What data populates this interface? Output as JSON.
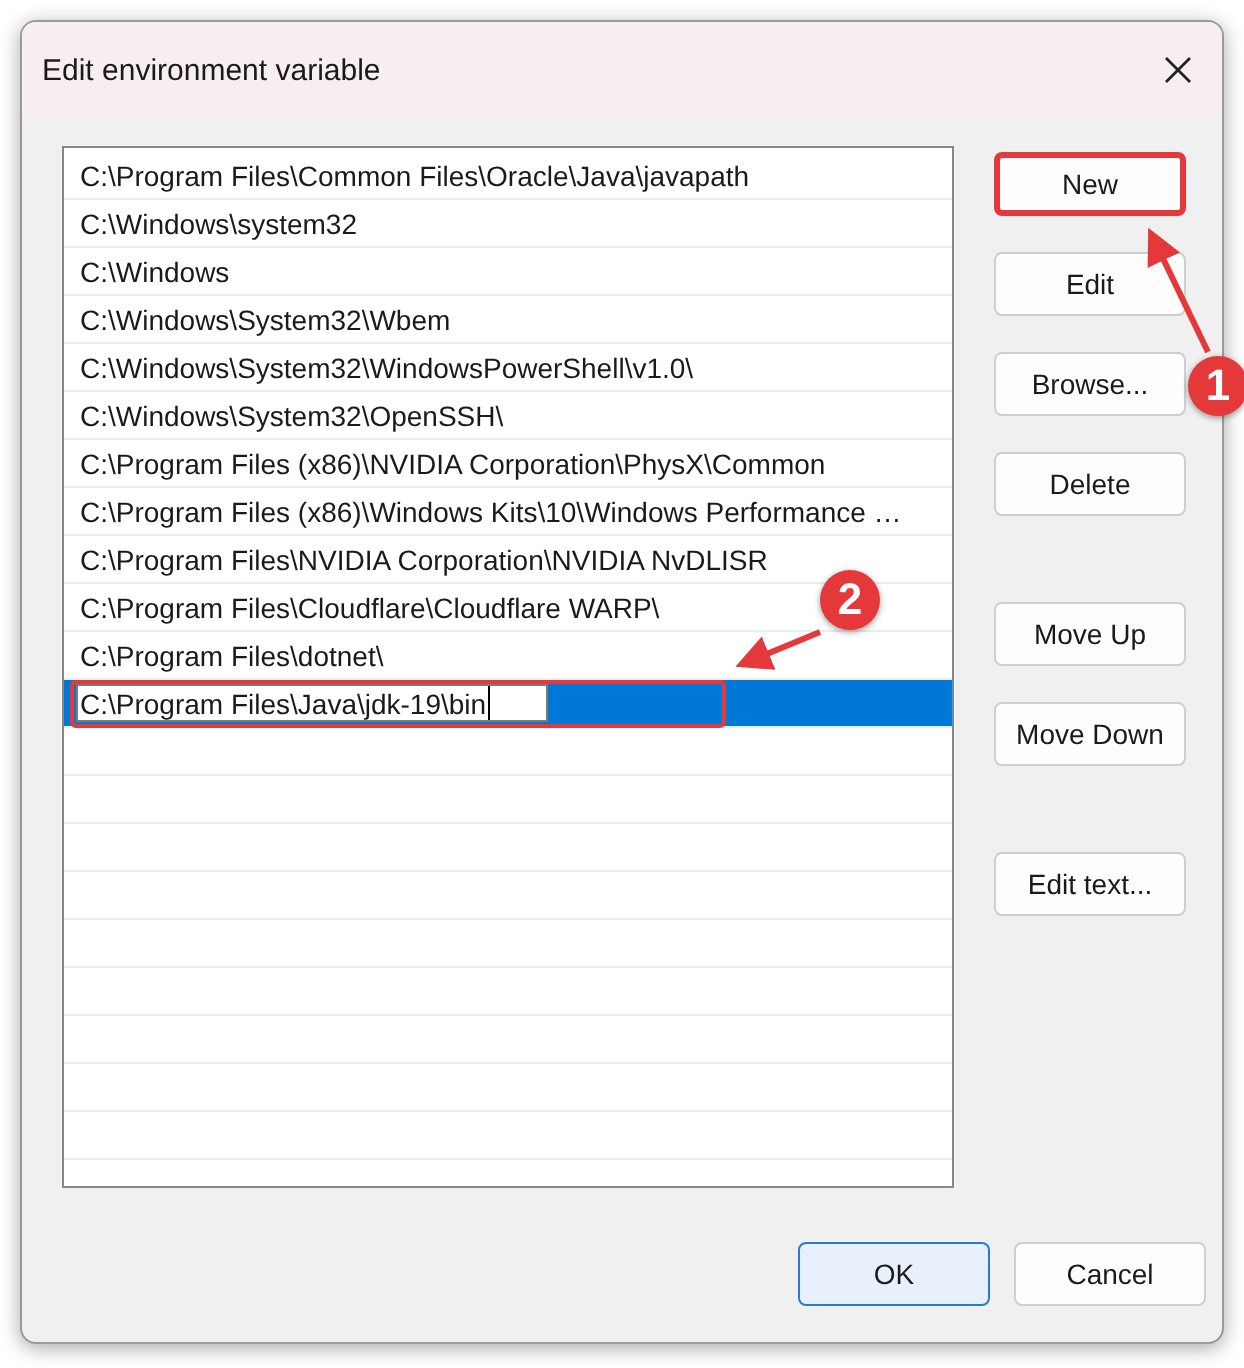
{
  "window": {
    "title": "Edit environment variable"
  },
  "paths": [
    {
      "text": "C:\\Program Files\\Common Files\\Oracle\\Java\\javapath",
      "selected": false,
      "editing": false
    },
    {
      "text": "C:\\Windows\\system32",
      "selected": false,
      "editing": false
    },
    {
      "text": "C:\\Windows",
      "selected": false,
      "editing": false
    },
    {
      "text": "C:\\Windows\\System32\\Wbem",
      "selected": false,
      "editing": false
    },
    {
      "text": "C:\\Windows\\System32\\WindowsPowerShell\\v1.0\\",
      "selected": false,
      "editing": false
    },
    {
      "text": "C:\\Windows\\System32\\OpenSSH\\",
      "selected": false,
      "editing": false
    },
    {
      "text": "C:\\Program Files (x86)\\NVIDIA Corporation\\PhysX\\Common",
      "selected": false,
      "editing": false
    },
    {
      "text": "C:\\Program Files (x86)\\Windows Kits\\10\\Windows Performance …",
      "selected": false,
      "editing": false
    },
    {
      "text": "C:\\Program Files\\NVIDIA Corporation\\NVIDIA NvDLISR",
      "selected": false,
      "editing": false
    },
    {
      "text": "C:\\Program Files\\Cloudflare\\Cloudflare WARP\\",
      "selected": false,
      "editing": false
    },
    {
      "text": "C:\\Program Files\\dotnet\\",
      "selected": false,
      "editing": false
    },
    {
      "text": "C:\\Program Files\\Java\\jdk-19\\bin",
      "selected": true,
      "editing": true,
      "highlighted": true
    }
  ],
  "side_buttons": [
    {
      "label": "New",
      "highlighted": true
    },
    {
      "label": "Edit",
      "highlighted": false
    },
    {
      "label": "Browse...",
      "highlighted": false
    },
    {
      "label": "Delete",
      "highlighted": false
    },
    {
      "label": "Move Up",
      "highlighted": false
    },
    {
      "label": "Move Down",
      "highlighted": false
    },
    {
      "label": "Edit text...",
      "highlighted": false
    }
  ],
  "footer_buttons": [
    {
      "label": "OK",
      "default": true
    },
    {
      "label": "Cancel",
      "default": false
    }
  ],
  "annotations": [
    {
      "label": "1"
    },
    {
      "label": "2"
    }
  ]
}
